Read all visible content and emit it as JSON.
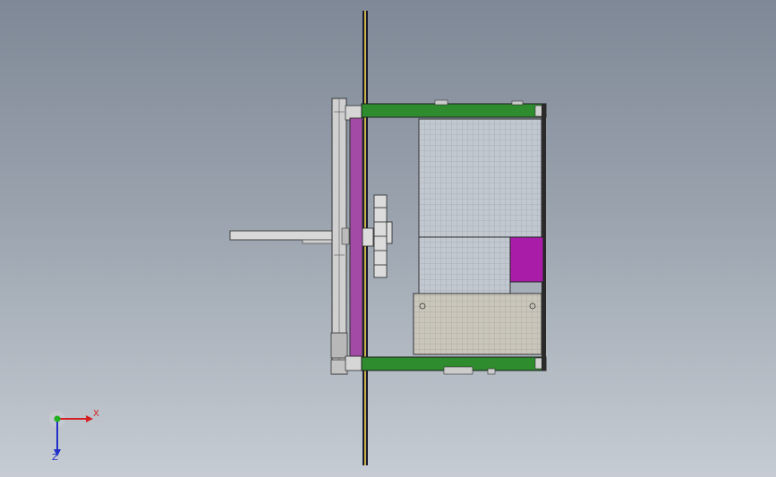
{
  "view": {
    "background_top": "#7f8896",
    "background_bottom": "#c6ccd3"
  },
  "model": {
    "frame_color": "#2e8b2e",
    "panel_color": "#a24aa6",
    "accent_panel_color": "#a81ca8",
    "mesh_color": "#bfc4cc",
    "rail_color": "#1a1a2e",
    "rail_highlight": "#c8b24a"
  },
  "triad": {
    "x_label": "X",
    "z_label": "Z",
    "x_color": "#d42020",
    "y_color": "#20b020",
    "z_color": "#2030c8"
  }
}
